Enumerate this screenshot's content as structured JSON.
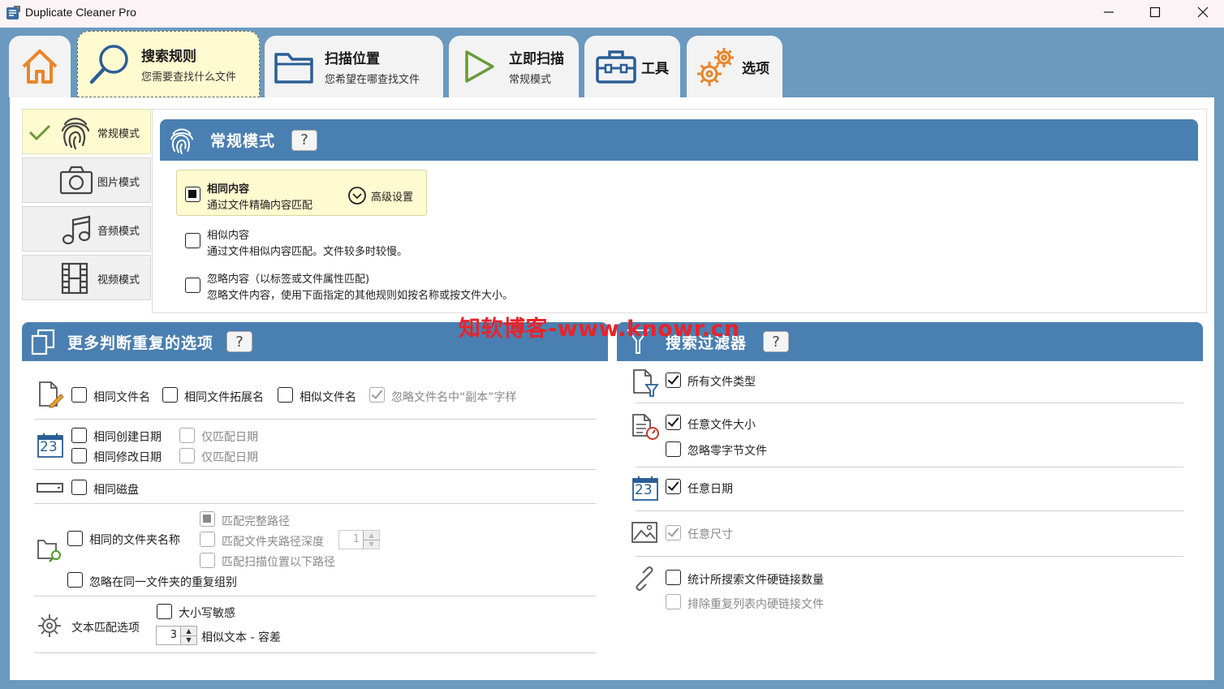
{
  "window": {
    "title": "Duplicate Cleaner Pro"
  },
  "tabs": [
    {
      "title": "",
      "subtitle": "",
      "icon": "home-icon"
    },
    {
      "title": "搜索规则",
      "subtitle": "您需要查找什么文件",
      "icon": "search-icon"
    },
    {
      "title": "扫描位置",
      "subtitle": "您希望在哪查找文件",
      "icon": "folder-icon"
    },
    {
      "title": "立即扫描",
      "subtitle": "常规模式",
      "icon": "play-icon"
    },
    {
      "title": "工具",
      "subtitle": "",
      "icon": "toolbox-icon"
    },
    {
      "title": "选项",
      "subtitle": "",
      "icon": "gears-icon"
    }
  ],
  "modes": [
    {
      "label": "常规模式",
      "icon": "fingerprint-icon",
      "active": true
    },
    {
      "label": "图片模式",
      "icon": "camera-icon"
    },
    {
      "label": "音频模式",
      "icon": "music-icon"
    },
    {
      "label": "视频模式",
      "icon": "film-icon"
    }
  ],
  "mode_panel": {
    "title": "常规模式",
    "help": "?",
    "options": [
      {
        "title": "相同内容",
        "desc": "通过文件精确内容匹配",
        "selected": true
      },
      {
        "title": "相似内容",
        "desc": "通过文件相似内容匹配。文件较多时较慢。"
      },
      {
        "title": "忽略内容（以标签或文件属性匹配)",
        "desc": "忽略文件内容，使用下面指定的其他规则如按名称或按文件大小。"
      }
    ],
    "advanced": "高级设置"
  },
  "more_options": {
    "title": "更多判断重复的选项",
    "help": "?",
    "same_filename": "相同文件名",
    "same_extension": "相同文件拓展名",
    "similar_filename": "相似文件名",
    "ignore_copy": "忽略文件名中“副本”字样",
    "same_created": "相同创建日期",
    "same_modified": "相同修改日期",
    "date_only_1": "仅匹配日期",
    "date_only_2": "仅匹配日期",
    "calendar_day": "23",
    "same_disk": "相同磁盘",
    "same_folder_name": "相同的文件夹名称",
    "match_full_path": "匹配完整路径",
    "match_path_depth": "匹配文件夹路径深度",
    "path_depth_value": "1",
    "match_below_scan": "匹配扫描位置以下路径",
    "ignore_same_folder": "忽略在同一文件夹的重复组别",
    "text_match": "文本匹配选项",
    "case_sensitive": "大小写敏感",
    "tolerance_value": "3",
    "similar_text": "相似文本 - 容差"
  },
  "filters": {
    "title": "搜索过滤器",
    "help": "?",
    "all_types": "所有文件类型",
    "any_size": "任意文件大小",
    "ignore_zero": "忽略零字节文件",
    "any_date": "任意日期",
    "calendar_day": "23",
    "any_dimension": "任意尺寸",
    "count_hardlinks": "统计所搜索文件硬链接数量",
    "exclude_hardlinks": "排除重复列表内硬链接文件"
  },
  "watermark": "知软博客-www.knowr.cn",
  "colors": {
    "header": "#4a7fb1",
    "accent": "#e8862a",
    "active_tab": "#fffbd0",
    "background": "#6b99bf"
  }
}
